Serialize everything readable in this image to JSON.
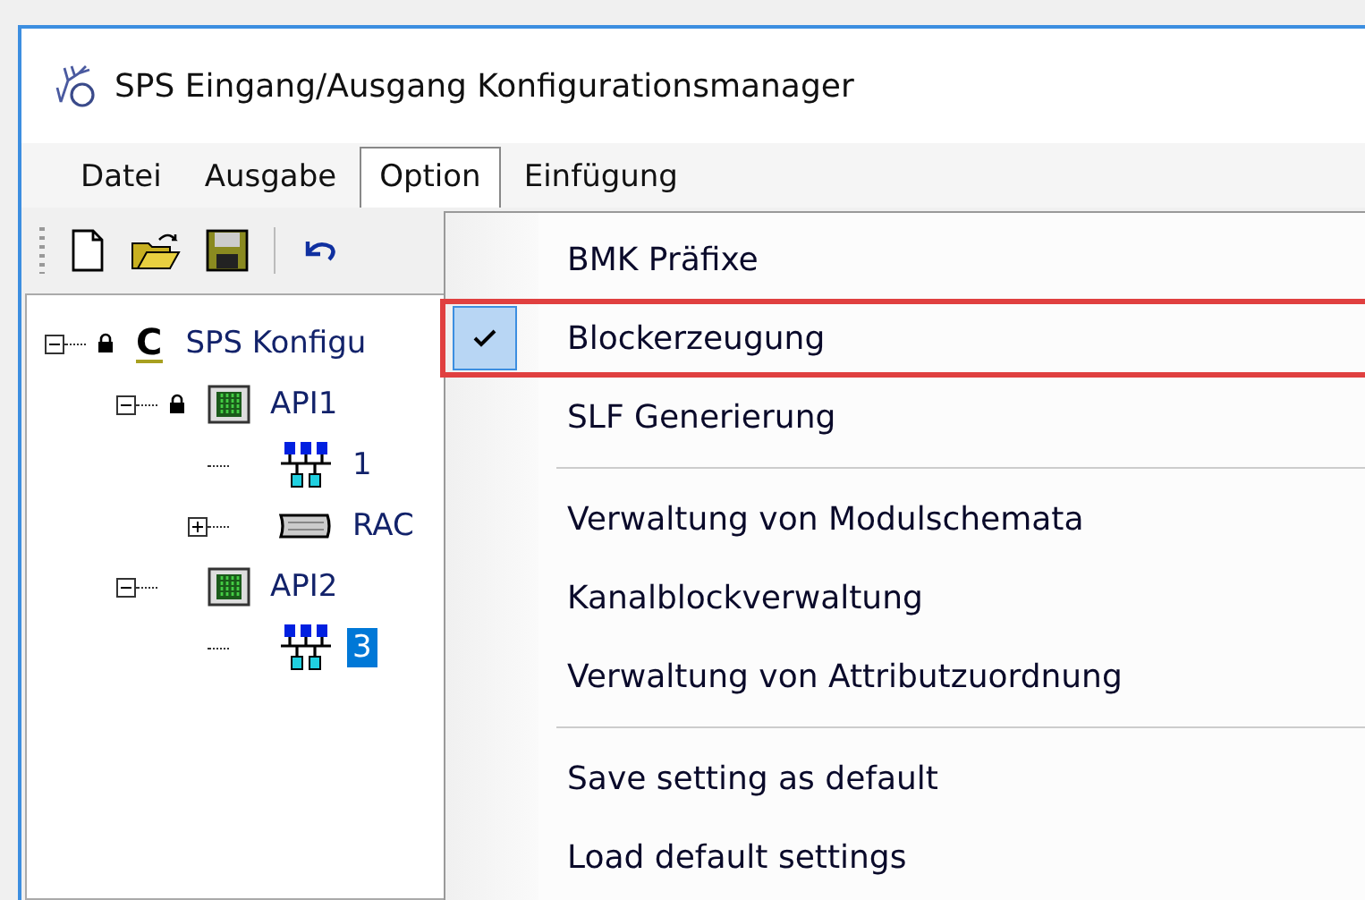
{
  "window": {
    "title": "SPS Eingang/Ausgang Konfigurationsmanager"
  },
  "menu_bar": [
    {
      "label": "Datei",
      "selected": false
    },
    {
      "label": "Ausgabe",
      "selected": false
    },
    {
      "label": "Option",
      "selected": true
    },
    {
      "label": "Einfügung",
      "selected": false
    }
  ],
  "toolbar": [
    {
      "kind": "new"
    },
    {
      "kind": "open"
    },
    {
      "kind": "save"
    },
    {
      "kind": "undo"
    }
  ],
  "tree": [
    {
      "label": "SPS Konfigu",
      "kind": "config",
      "icon_letter": "C",
      "locked": true,
      "expanded": true,
      "selected": false,
      "children": [
        {
          "label": "API1",
          "kind": "api",
          "locked": true,
          "expanded": true,
          "selected": false,
          "children": [
            {
              "label": "1",
              "kind": "network",
              "locked": false,
              "selected": false
            },
            {
              "label": "RAC",
              "kind": "rack",
              "locked": false,
              "expanded": false,
              "selected": false
            }
          ]
        },
        {
          "label": "API2",
          "kind": "api",
          "locked": false,
          "expanded": true,
          "selected": false,
          "children": [
            {
              "label": "3",
              "kind": "network",
              "locked": false,
              "selected": true
            }
          ]
        }
      ]
    }
  ],
  "option_menu": [
    {
      "label": "BMK Präfixe",
      "checked": false,
      "highlighted": false
    },
    {
      "label": "Blockerzeugung",
      "checked": true,
      "highlighted": true
    },
    {
      "label": "SLF Generierung",
      "checked": false,
      "highlighted": false
    },
    {
      "kind": "separator"
    },
    {
      "label": "Verwaltung von Modulschemata",
      "checked": false,
      "highlighted": false
    },
    {
      "label": "Kanalblockverwaltung",
      "checked": false,
      "highlighted": false
    },
    {
      "label": "Verwaltung von Attributzuordnung",
      "checked": false,
      "highlighted": false
    },
    {
      "kind": "separator"
    },
    {
      "label": "Save setting as default",
      "checked": false,
      "highlighted": false
    },
    {
      "label": "Load default settings",
      "checked": false,
      "highlighted": false
    }
  ]
}
